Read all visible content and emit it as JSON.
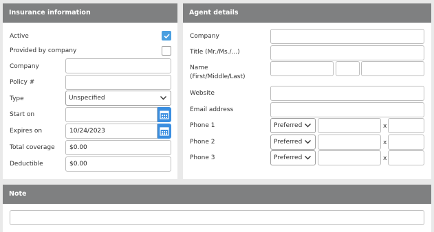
{
  "insurance": {
    "title": "Insurance information",
    "active_label": "Active",
    "active_checked": true,
    "provided_label": "Provided by company",
    "provided_checked": false,
    "company_label": "Company",
    "company_value": "",
    "policy_label": "Policy #",
    "policy_value": "",
    "type_label": "Type",
    "type_value": "Unspecified",
    "start_label": "Start on",
    "start_value": "",
    "expires_label": "Expires on",
    "expires_value": "10/24/2023",
    "coverage_label": "Total coverage",
    "coverage_value": "$0.00",
    "deductible_label": "Deductible",
    "deductible_value": "$0.00"
  },
  "agent": {
    "title": "Agent details",
    "company_label": "Company",
    "title_label": "Title (Mr./Ms./...)",
    "name_label": "Name (First/Middle/Last)",
    "website_label": "Website",
    "email_label": "Email address",
    "phones": [
      {
        "label": "Phone 1",
        "type": "Preferred",
        "sep": "x"
      },
      {
        "label": "Phone 2",
        "type": "Preferred",
        "sep": "x"
      },
      {
        "label": "Phone 3",
        "type": "Preferred",
        "sep": "x"
      }
    ]
  },
  "note": {
    "title": "Note",
    "value": ""
  },
  "colors": {
    "header_bg": "#7f8081",
    "accent": "#3a8ee0"
  },
  "icons": [
    "check-icon",
    "chevron-down-icon",
    "calendar-icon"
  ]
}
